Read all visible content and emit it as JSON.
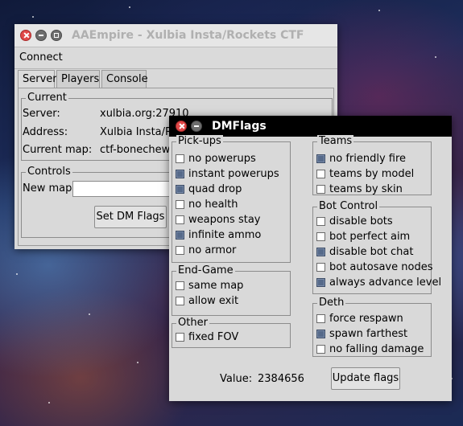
{
  "main_window": {
    "title": "AAEmpire - Xulbia Insta/Rockets CTF",
    "menu": [
      "Connect"
    ],
    "tabs": [
      {
        "label": "Server",
        "active": true
      },
      {
        "label": "Players",
        "active": false
      },
      {
        "label": "Console",
        "active": false
      }
    ],
    "current": {
      "legend": "Current",
      "server_label": "Server:",
      "server_value": "xulbia.org:27910",
      "address_label": "Address:",
      "address_value": "Xulbia Insta/Rockets CTF",
      "map_label": "Current map:",
      "map_value": "ctf-bonecheweu"
    },
    "controls": {
      "legend": "Controls",
      "new_map_label": "New map:",
      "new_map_value": "",
      "set_flags_button": "Set DM Flags"
    }
  },
  "dmflags_window": {
    "title": "DMFlags",
    "pickups": {
      "legend": "Pick-ups",
      "items": [
        {
          "label": "no powerups",
          "checked": false
        },
        {
          "label": "instant powerups",
          "checked": true
        },
        {
          "label": "quad drop",
          "checked": true
        },
        {
          "label": "no health",
          "checked": false
        },
        {
          "label": "weapons stay",
          "checked": false
        },
        {
          "label": "infinite ammo",
          "checked": true
        },
        {
          "label": "no armor",
          "checked": false
        }
      ]
    },
    "endgame": {
      "legend": "End-Game",
      "items": [
        {
          "label": "same map",
          "checked": false
        },
        {
          "label": "allow exit",
          "checked": false
        }
      ]
    },
    "other": {
      "legend": "Other",
      "items": [
        {
          "label": "fixed FOV",
          "checked": false
        }
      ]
    },
    "teams": {
      "legend": "Teams",
      "items": [
        {
          "label": "no friendly fire",
          "checked": true
        },
        {
          "label": "teams by model",
          "checked": false
        },
        {
          "label": "teams by skin",
          "checked": false
        }
      ]
    },
    "botcontrol": {
      "legend": "Bot Control",
      "items": [
        {
          "label": "disable bots",
          "checked": false
        },
        {
          "label": "bot perfect aim",
          "checked": false
        },
        {
          "label": "disable bot chat",
          "checked": true
        },
        {
          "label": "bot autosave nodes",
          "checked": false
        },
        {
          "label": "always advance level",
          "checked": true
        }
      ]
    },
    "deth": {
      "legend": "Deth",
      "items": [
        {
          "label": "force respawn",
          "checked": false
        },
        {
          "label": "spawn farthest",
          "checked": true
        },
        {
          "label": "no falling damage",
          "checked": false
        }
      ]
    },
    "value_label": "Value:",
    "value": "2384656",
    "update_button": "Update flags"
  }
}
